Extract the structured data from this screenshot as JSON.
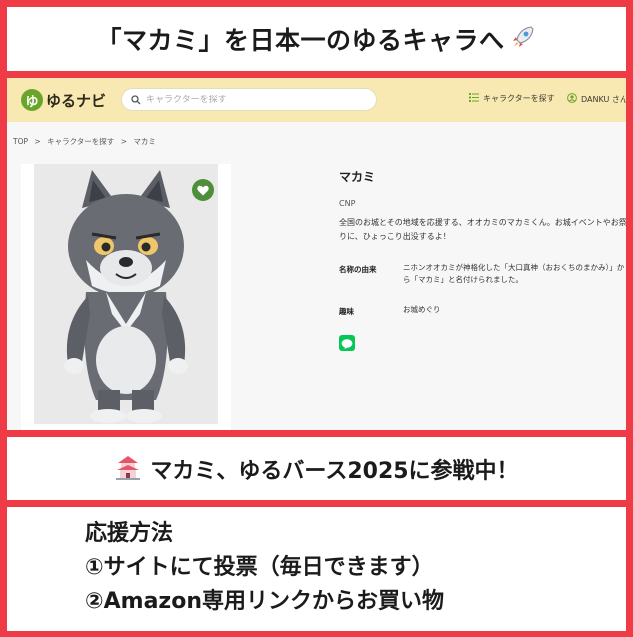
{
  "top_banner": {
    "text": "「マカミ」を日本一のゆるキャラへ",
    "icon": "rocket-icon"
  },
  "site": {
    "logo_text": "ゆるナビ",
    "logo_mark": "ゆ",
    "search_placeholder": "キャラクターを探す",
    "nav_search_label": "キャラクターを探す",
    "nav_user_label": "DANKU さん",
    "header_color": "#f8e9b3"
  },
  "breadcrumb": {
    "items": [
      "TOP",
      ">",
      "キャラクターを探す",
      ">",
      "マカミ"
    ]
  },
  "character": {
    "name": "マカミ",
    "group": "CNP",
    "description": "全国のお城とその地域を応援する、オオカミのマカミくん。お城イベントやお祭りに、ひょっこり出没するよ！",
    "fields": [
      {
        "label": "名称の由来",
        "value": "ニホンオオカミが神格化した「大口真神（おおくちのまかみ）」から「マカミ」と名付けられました。"
      },
      {
        "label": "趣味",
        "value": "お城めぐり"
      }
    ]
  },
  "mid_banner": {
    "text": "マカミ、ゆるバース2025に参戦中！",
    "icon": "castle-icon"
  },
  "bottom": {
    "lines": [
      "応援方法",
      "①サイトにて投票（毎日できます）",
      "②Amazon専用リンクからお買い物"
    ]
  },
  "colors": {
    "frame": "#ef3b46",
    "favorite": "#4e8f3b",
    "line": "#06c755"
  }
}
